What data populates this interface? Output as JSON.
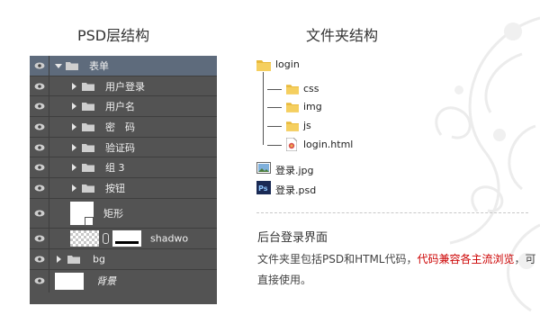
{
  "headings": {
    "psd": "PSD层结构",
    "folder": "文件夹结构"
  },
  "psd_layers": [
    {
      "label": "表单",
      "kind": "folder",
      "expanded": true,
      "selected": true
    },
    {
      "label": "用户登录",
      "kind": "folder",
      "expanded": false
    },
    {
      "label": "用户名",
      "kind": "folder",
      "expanded": false
    },
    {
      "label": "密　码",
      "kind": "folder",
      "expanded": false
    },
    {
      "label": "验证码",
      "kind": "folder",
      "expanded": false
    },
    {
      "label": "组 3",
      "kind": "folder",
      "expanded": false
    },
    {
      "label": "按钮",
      "kind": "folder",
      "expanded": false
    },
    {
      "label": "矩形",
      "kind": "shape"
    },
    {
      "label": "shadwo",
      "kind": "masked"
    },
    {
      "label": "bg",
      "kind": "folder",
      "expanded": false
    },
    {
      "label": "背景",
      "kind": "background"
    }
  ],
  "folder_tree": {
    "root": "login",
    "children": [
      "css",
      "img",
      "js",
      "login.html"
    ],
    "files": [
      "登录.jpg",
      "登录.psd"
    ]
  },
  "info": {
    "title": "后台登录界面",
    "text_before": "文件夹里包括PSD和HTML代码，",
    "text_highlight": "代码兼容各主流浏览",
    "text_after": "，可直接使用。"
  },
  "colors": {
    "panel": "#535353",
    "selected_row": "#5e6b7c",
    "highlight": "#cc0000",
    "folder_yellow": "#e8b93a"
  }
}
